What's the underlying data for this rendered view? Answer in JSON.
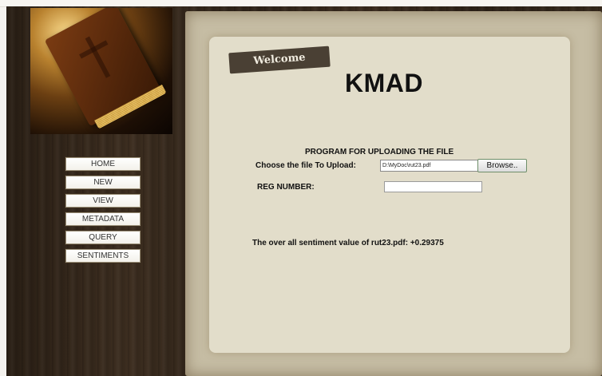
{
  "welcome_label": "Welcome",
  "site_title": "KMAD",
  "nav": {
    "items": [
      {
        "label": "HOME"
      },
      {
        "label": "NEW"
      },
      {
        "label": "VIEW"
      },
      {
        "label": "METADATA"
      },
      {
        "label": "QUERY"
      },
      {
        "label": "SENTIMENTS"
      }
    ]
  },
  "upload": {
    "heading": "PROGRAM FOR UPLOADING THE FILE",
    "file_label": "Choose the file To Upload:",
    "file_value": "D:\\MyDoc\\rut23.pdf",
    "browse_label": "Browse..",
    "reg_label": "REG NUMBER:",
    "reg_value": ""
  },
  "result": {
    "sentiment_text": "The over all sentiment value of rut23.pdf: +0.29375"
  },
  "colors": {
    "wood_dark": "#2a1f15",
    "parchment": "#e2ddca",
    "welcome_tag": "#4a4034"
  },
  "hero_image": "bible-book"
}
